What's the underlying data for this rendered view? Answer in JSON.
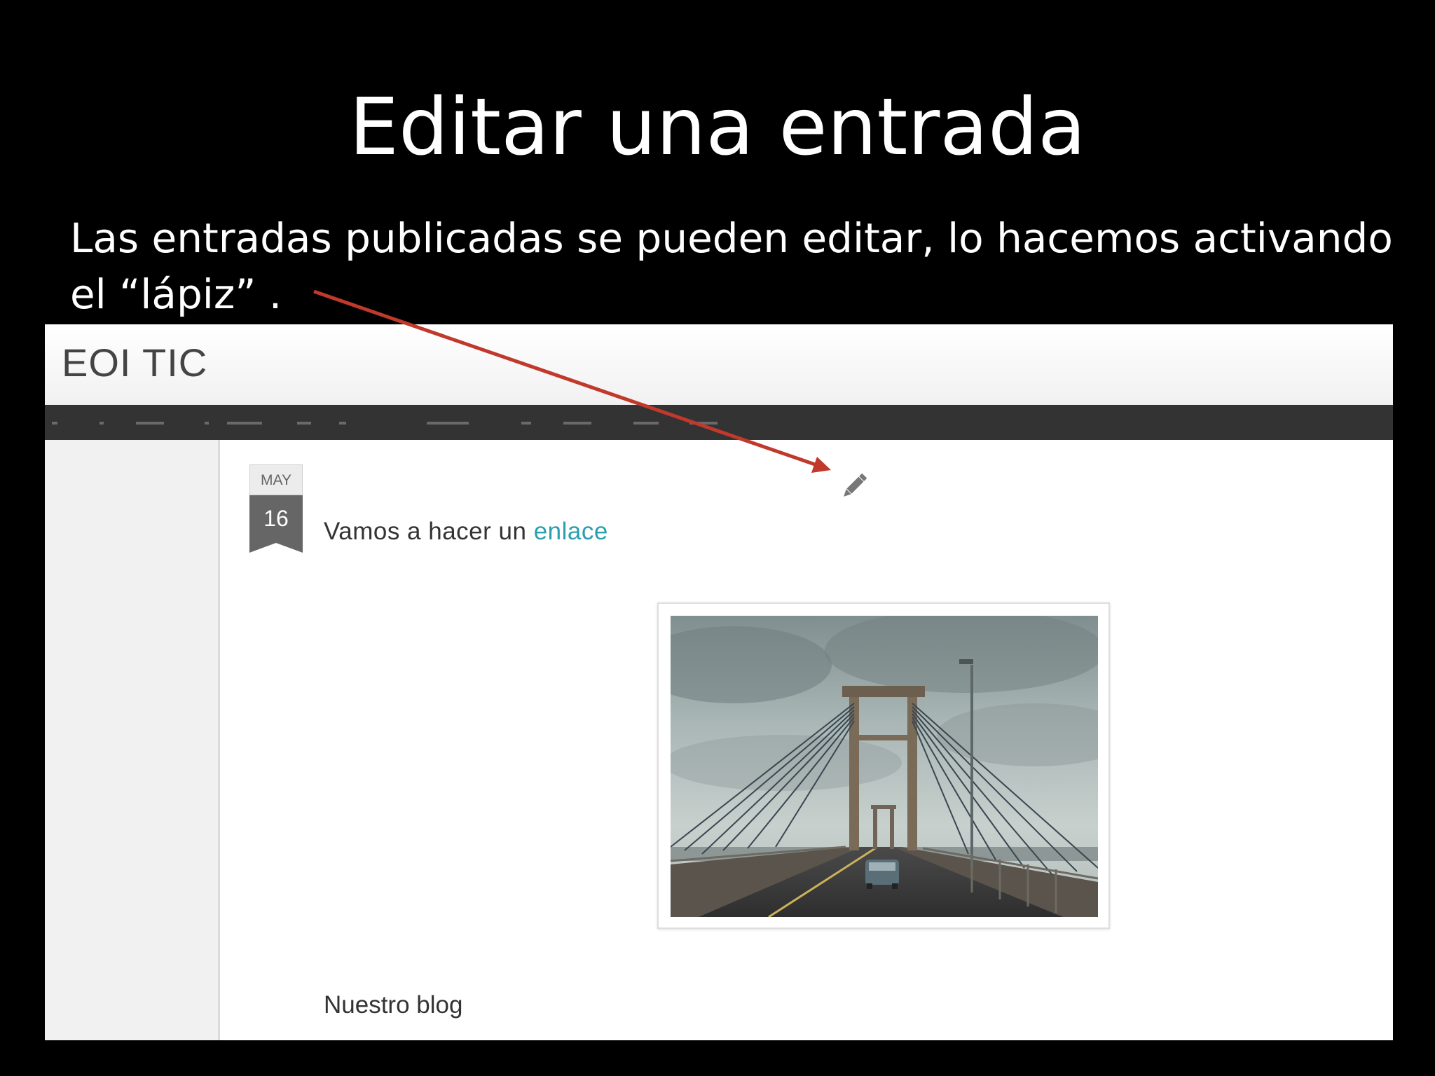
{
  "slide": {
    "title": "Editar una entrada",
    "body": "Las entradas publicadas se pueden editar, lo  hacemos activando el “lápiz” ."
  },
  "blog": {
    "title": "EOI TIC",
    "post": {
      "date_month": "MAY",
      "date_day": "16",
      "title_prefix": "Vamos a hacer un ",
      "title_link": "enlace",
      "edit_icon": "pencil-icon"
    },
    "section_title": "Nuestro blog"
  },
  "colors": {
    "background": "#000000",
    "annotation_arrow": "#c0392b",
    "link": "#2a9fb0",
    "nav_bar": "#333333"
  }
}
